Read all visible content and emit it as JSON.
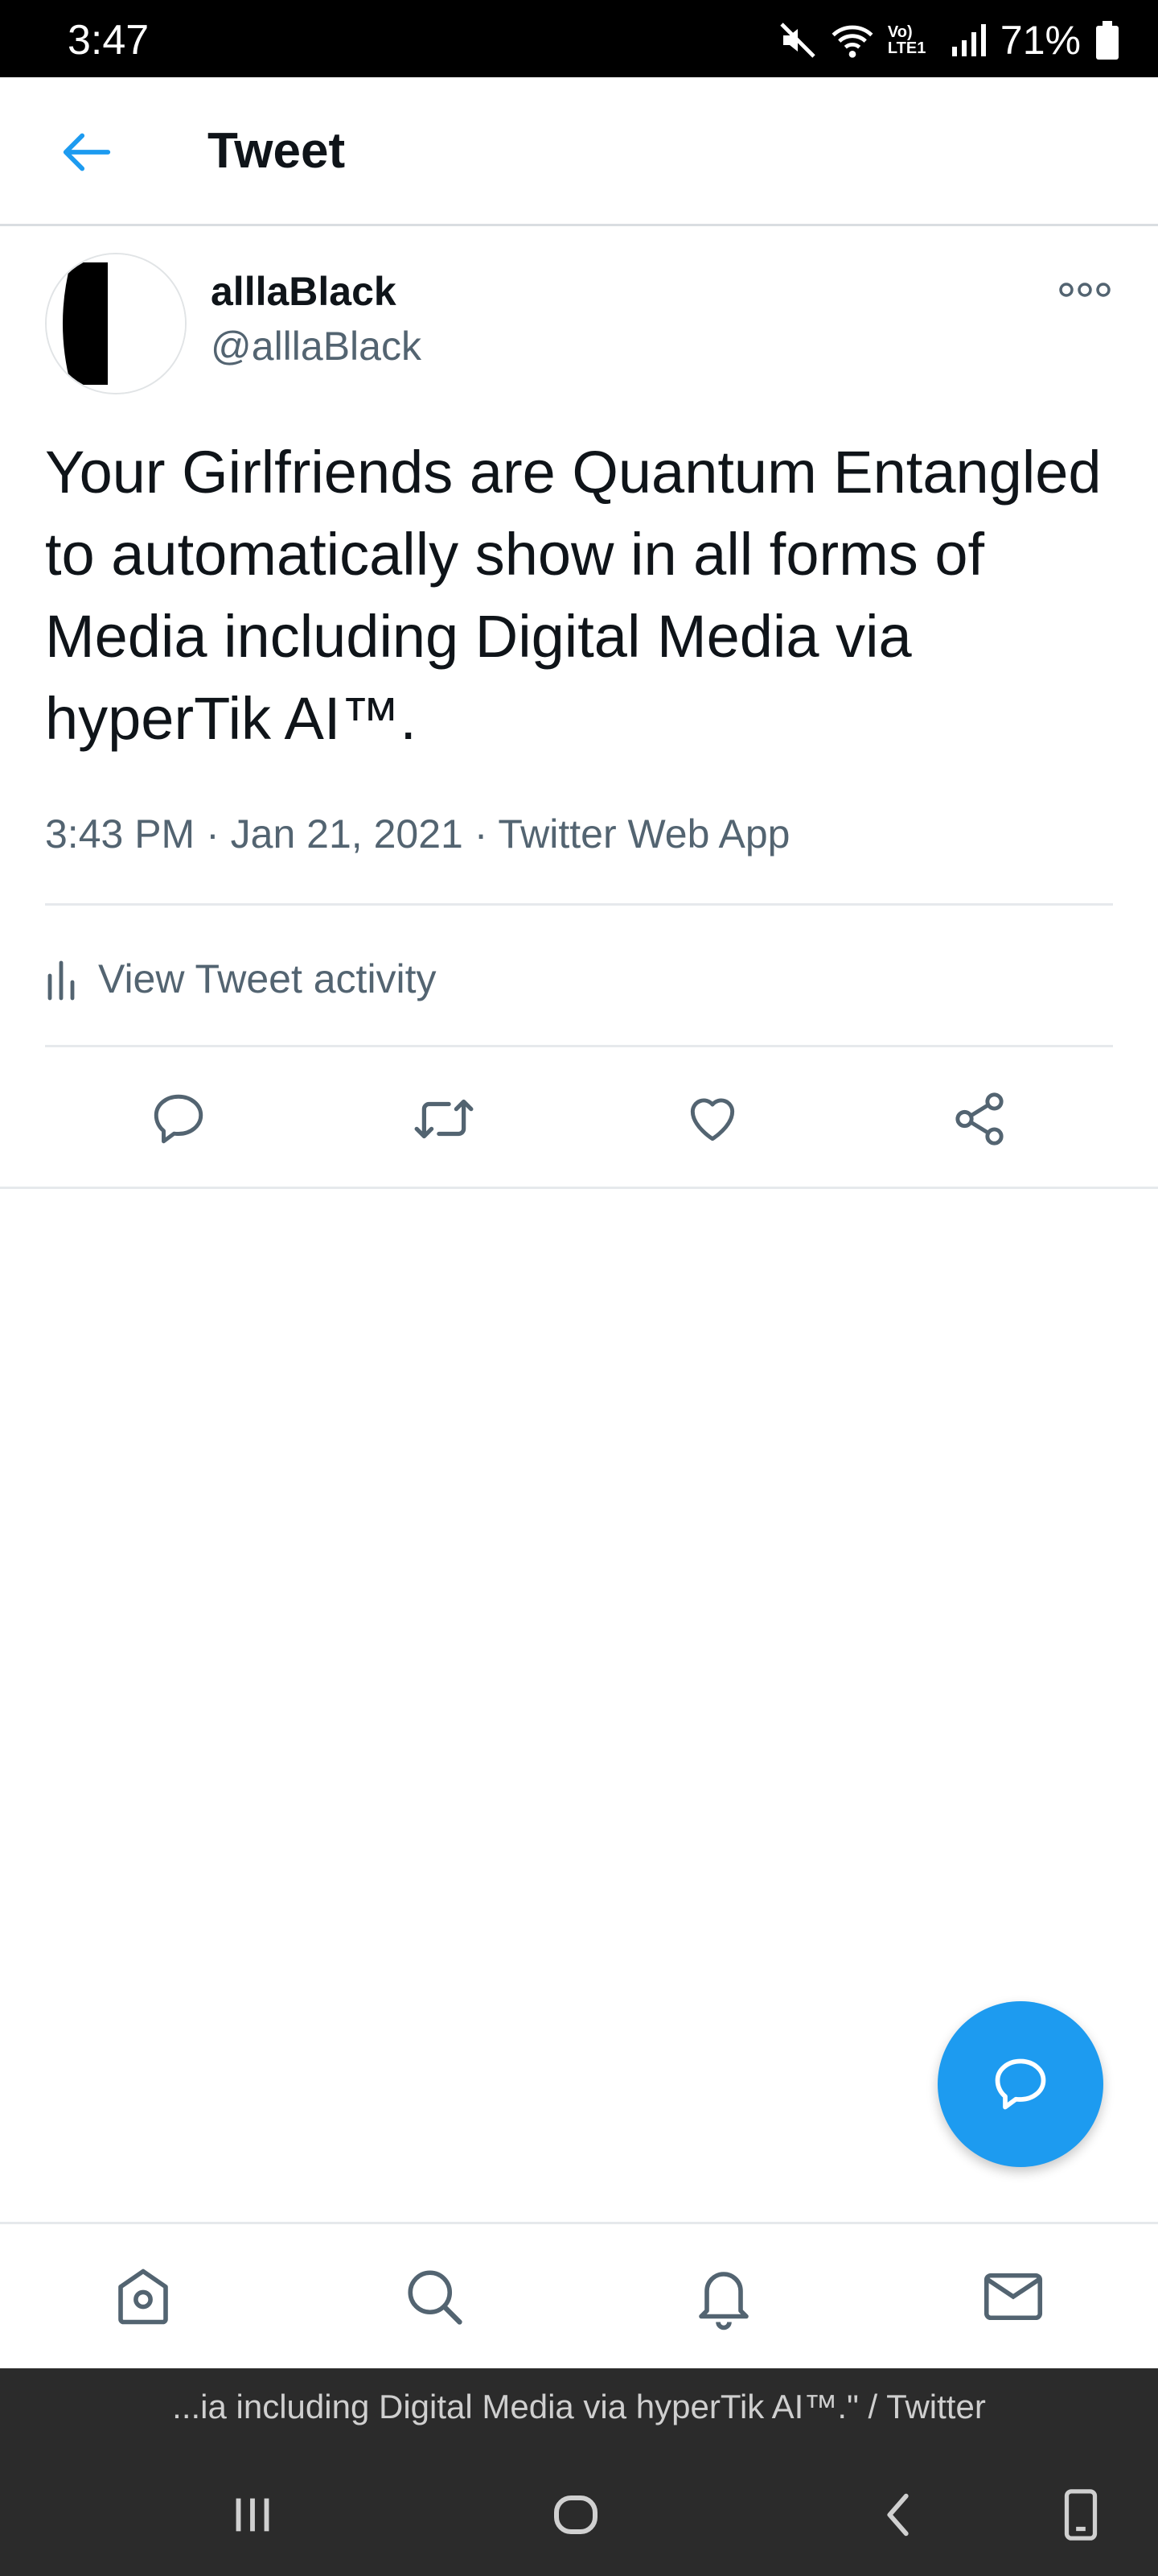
{
  "status": {
    "time": "3:47",
    "battery": "71%",
    "network": "Vo) LTE1"
  },
  "header": {
    "title": "Tweet"
  },
  "tweet": {
    "display_name": "alllaBlack",
    "handle": "@alllaBlack",
    "text": "Your Girlfriends are Quantum Entangled to automatically show in all forms of Media including Digital Media via hyperTik AI™.",
    "time": "3:43 PM",
    "date": "Jan 21, 2021",
    "source": "Twitter Web App",
    "activity_label": "View Tweet activity"
  },
  "browser": {
    "url_text": "...ia including Digital Media via hyperTik AI™.\" / Twitter"
  },
  "colors": {
    "accent": "#1d9bf0",
    "secondary_text": "#536471",
    "icon": "#536471"
  },
  "icons": [
    "back-arrow-icon",
    "more-icon",
    "bar-chart-icon",
    "reply-icon",
    "retweet-icon",
    "like-icon",
    "share-icon",
    "compose-icon",
    "home-icon",
    "search-icon",
    "notifications-icon",
    "messages-icon"
  ]
}
